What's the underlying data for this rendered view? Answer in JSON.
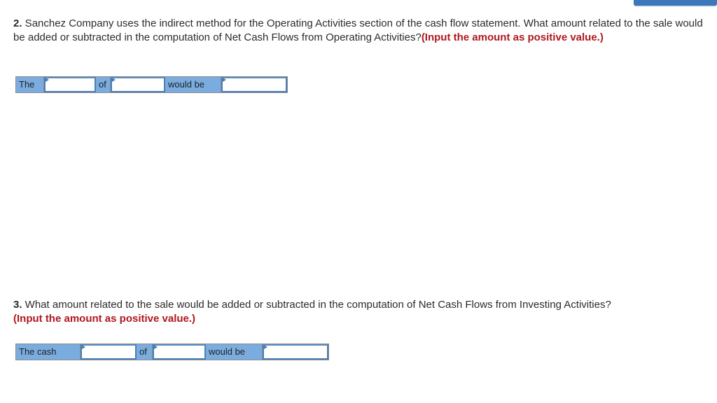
{
  "header": {
    "top_button_label": ""
  },
  "questions": [
    {
      "number": "2.",
      "text": " Sanchez Company uses the indirect method for the Operating Activities section of the cash flow statement. What amount related to the sale would be added or subtracted in the computation of Net Cash Flows from Operating Activities?",
      "hint": "(Input the amount as positive value.)",
      "fill_row": {
        "labels": [
          "The",
          "of",
          "would be"
        ],
        "inputs": [
          {
            "value": "",
            "placeholder": ""
          },
          {
            "value": "",
            "placeholder": ""
          },
          {
            "value": "",
            "placeholder": ""
          }
        ]
      }
    },
    {
      "number": "3.",
      "text": " What amount related to the sale would be added or subtracted in the computation of Net Cash Flows from Investing Activities?",
      "hint": "(Input the amount as positive value.)",
      "fill_row": {
        "labels": [
          "The cash",
          "of",
          "would be"
        ],
        "inputs": [
          {
            "value": "",
            "placeholder": ""
          },
          {
            "value": "",
            "placeholder": ""
          },
          {
            "value": "",
            "placeholder": ""
          }
        ]
      }
    }
  ],
  "colors": {
    "hint": "#b0171f",
    "label_bg": "#7bacdf",
    "input_border": "#4a7fb8",
    "top_button": "#3c78b9"
  }
}
